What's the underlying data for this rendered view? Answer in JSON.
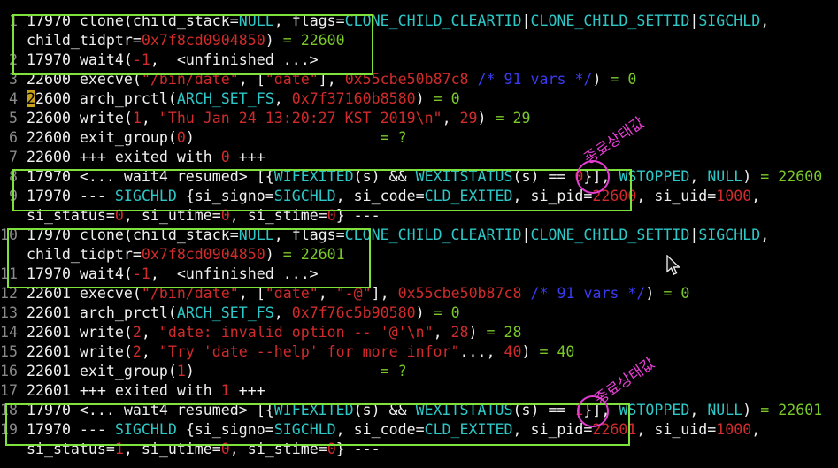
{
  "colors": {
    "default": "#f0f0f0",
    "lineno": "#8a8a8a",
    "number": "#d12b2b",
    "string": "#d12b2b",
    "const": "#2ec7c7",
    "comment": "#3a3af2",
    "result": "#7ac92a",
    "annot": "#e43fd2",
    "highlight_bg": "#c9a21c",
    "box": "#7ee23a"
  },
  "lines": [
    {
      "seg": [
        [
          "ln",
          " 1 "
        ],
        [
          "d",
          "17970 clone("
        ],
        [
          "d",
          "child_stack="
        ],
        [
          "c",
          "NULL"
        ],
        [
          "d",
          ", flags="
        ],
        [
          "c",
          "CLONE_CHILD_CLEARTID"
        ],
        [
          "d",
          "|"
        ],
        [
          "c",
          "CLONE_CHILD_SETTID"
        ],
        [
          "d",
          "|"
        ],
        [
          "c",
          "SIGCHLD"
        ],
        [
          "d",
          ","
        ]
      ]
    },
    {
      "seg": [
        [
          "d",
          "   child_tidptr="
        ],
        [
          "n",
          "0x7f8cd0904850"
        ],
        [
          "d",
          ")"
        ],
        [
          "r",
          " = 22600"
        ]
      ]
    },
    {
      "seg": [
        [
          "ln",
          " 2 "
        ],
        [
          "d",
          "17970 wait4("
        ],
        [
          "n",
          "-1"
        ],
        [
          "d",
          ",  <unfinished ...>"
        ]
      ]
    },
    {
      "seg": [
        [
          "ln",
          " 3 "
        ],
        [
          "d",
          "22600 execve("
        ],
        [
          "s",
          "\"/bin/date\""
        ],
        [
          "d",
          ", ["
        ],
        [
          "s",
          "\"date\""
        ],
        [
          "d",
          "], "
        ],
        [
          "n",
          "0x55cbe50b87c8"
        ],
        [
          "d",
          " "
        ],
        [
          "m",
          "/* 91 vars */"
        ],
        [
          "d",
          ")"
        ],
        [
          "r",
          " = 0"
        ]
      ]
    },
    {
      "seg": [
        [
          "ln",
          " 4 "
        ],
        [
          "h",
          "2"
        ],
        [
          "d",
          "2600 arch_prctl("
        ],
        [
          "c",
          "ARCH_SET_FS"
        ],
        [
          "d",
          ", "
        ],
        [
          "n",
          "0x7f37160b8580"
        ],
        [
          "d",
          ")"
        ],
        [
          "r",
          " = 0"
        ]
      ]
    },
    {
      "seg": [
        [
          "ln",
          " 5 "
        ],
        [
          "d",
          "22600 write("
        ],
        [
          "n",
          "1"
        ],
        [
          "d",
          ", "
        ],
        [
          "s",
          "\"Thu Jan 24 13:20:27 KST 2019\\n\""
        ],
        [
          "d",
          ", "
        ],
        [
          "n",
          "29"
        ],
        [
          "d",
          ")"
        ],
        [
          "r",
          " = 29"
        ]
      ]
    },
    {
      "seg": [
        [
          "ln",
          " 6 "
        ],
        [
          "d",
          "22600 exit_group("
        ],
        [
          "n",
          "0"
        ],
        [
          "d",
          ")                     "
        ],
        [
          "r",
          "= ?"
        ]
      ]
    },
    {
      "seg": [
        [
          "ln",
          " 7 "
        ],
        [
          "d",
          "22600 +++ exited with "
        ],
        [
          "n",
          "0"
        ],
        [
          "d",
          " +++"
        ]
      ]
    },
    {
      "seg": [
        [
          "ln",
          " 8 "
        ],
        [
          "d",
          "17970 <... wait4 resumed> [{"
        ],
        [
          "c",
          "WIFEXITED"
        ],
        [
          "d",
          "(s) && "
        ],
        [
          "c",
          "WEXITSTATUS"
        ],
        [
          "d",
          "(s) == "
        ],
        [
          "n",
          "0"
        ],
        [
          "d",
          "}], "
        ],
        [
          "c",
          "WSTOPPED"
        ],
        [
          "d",
          ", "
        ],
        [
          "c",
          "NULL"
        ],
        [
          "d",
          ")"
        ],
        [
          "r",
          " = 22600"
        ]
      ]
    },
    {
      "seg": [
        [
          "ln",
          " 9 "
        ],
        [
          "d",
          "17970 --- "
        ],
        [
          "c",
          "SIGCHLD"
        ],
        [
          "d",
          " {si_signo="
        ],
        [
          "c",
          "SIGCHLD"
        ],
        [
          "d",
          ", si_code="
        ],
        [
          "c",
          "CLD_EXITED"
        ],
        [
          "d",
          ", si_pid="
        ],
        [
          "n",
          "22600"
        ],
        [
          "d",
          ", si_uid="
        ],
        [
          "n",
          "1000"
        ],
        [
          "d",
          ","
        ]
      ]
    },
    {
      "seg": [
        [
          "d",
          "   si_status="
        ],
        [
          "n",
          "0"
        ],
        [
          "d",
          ", si_utime="
        ],
        [
          "n",
          "0"
        ],
        [
          "d",
          ", si_stime="
        ],
        [
          "n",
          "0"
        ],
        [
          "d",
          "} ---"
        ]
      ]
    },
    {
      "seg": [
        [
          "ln",
          "10 "
        ],
        [
          "d",
          "17970 clone("
        ],
        [
          "d",
          "child_stack="
        ],
        [
          "c",
          "NULL"
        ],
        [
          "d",
          ", flags="
        ],
        [
          "c",
          "CLONE_CHILD_CLEARTID"
        ],
        [
          "d",
          "|"
        ],
        [
          "c",
          "CLONE_CHILD_SETTID"
        ],
        [
          "d",
          "|"
        ],
        [
          "c",
          "SIGCHLD"
        ],
        [
          "d",
          ","
        ]
      ]
    },
    {
      "seg": [
        [
          "d",
          "   child_tidptr="
        ],
        [
          "n",
          "0x7f8cd0904850"
        ],
        [
          "d",
          ")"
        ],
        [
          "r",
          " = 22601"
        ]
      ]
    },
    {
      "seg": [
        [
          "ln",
          "11 "
        ],
        [
          "d",
          "17970 wait4("
        ],
        [
          "n",
          "-1"
        ],
        [
          "d",
          ",  <unfinished ...>"
        ]
      ]
    },
    {
      "seg": [
        [
          "ln",
          "12 "
        ],
        [
          "d",
          "22601 execve("
        ],
        [
          "s",
          "\"/bin/date\""
        ],
        [
          "d",
          ", ["
        ],
        [
          "s",
          "\"date\""
        ],
        [
          "d",
          ", "
        ],
        [
          "s",
          "\"-@\""
        ],
        [
          "d",
          "], "
        ],
        [
          "n",
          "0x55cbe50b87c8"
        ],
        [
          "d",
          " "
        ],
        [
          "m",
          "/* 91 vars */"
        ],
        [
          "d",
          ")"
        ],
        [
          "r",
          " = 0"
        ]
      ]
    },
    {
      "seg": [
        [
          "ln",
          "13 "
        ],
        [
          "d",
          "22601 arch_prctl("
        ],
        [
          "c",
          "ARCH_SET_FS"
        ],
        [
          "d",
          ", "
        ],
        [
          "n",
          "0x7f76c5b90580"
        ],
        [
          "d",
          ")"
        ],
        [
          "r",
          " = 0"
        ]
      ]
    },
    {
      "seg": [
        [
          "ln",
          "14 "
        ],
        [
          "d",
          "22601 write("
        ],
        [
          "n",
          "2"
        ],
        [
          "d",
          ", "
        ],
        [
          "s",
          "\"date: invalid option -- '@'\\n\""
        ],
        [
          "d",
          ", "
        ],
        [
          "n",
          "28"
        ],
        [
          "d",
          ")"
        ],
        [
          "r",
          " = 28"
        ]
      ]
    },
    {
      "seg": [
        [
          "ln",
          "15 "
        ],
        [
          "d",
          "22601 write("
        ],
        [
          "n",
          "2"
        ],
        [
          "d",
          ", "
        ],
        [
          "s",
          "\"Try 'date --help' for more infor\""
        ],
        [
          "d",
          "..., "
        ],
        [
          "n",
          "40"
        ],
        [
          "d",
          ")"
        ],
        [
          "r",
          " = 40"
        ]
      ]
    },
    {
      "seg": [
        [
          "ln",
          "16 "
        ],
        [
          "d",
          "22601 exit_group("
        ],
        [
          "n",
          "1"
        ],
        [
          "d",
          ")                     "
        ],
        [
          "r",
          "= ?"
        ]
      ]
    },
    {
      "seg": [
        [
          "ln",
          "17 "
        ],
        [
          "d",
          "22601 +++ exited with "
        ],
        [
          "n",
          "1"
        ],
        [
          "d",
          " +++"
        ]
      ]
    },
    {
      "seg": [
        [
          "ln",
          "18 "
        ],
        [
          "d",
          "17970 <... wait4 resumed> [{"
        ],
        [
          "c",
          "WIFEXITED"
        ],
        [
          "d",
          "(s) && "
        ],
        [
          "c",
          "WEXITSTATUS"
        ],
        [
          "d",
          "(s) == "
        ],
        [
          "n",
          "1"
        ],
        [
          "d",
          "}], "
        ],
        [
          "c",
          "WSTOPPED"
        ],
        [
          "d",
          ", "
        ],
        [
          "c",
          "NULL"
        ],
        [
          "d",
          ")"
        ],
        [
          "r",
          " = 22601"
        ]
      ]
    },
    {
      "seg": [
        [
          "ln",
          "19 "
        ],
        [
          "d",
          "17970 --- "
        ],
        [
          "c",
          "SIGCHLD"
        ],
        [
          "d",
          " {si_signo="
        ],
        [
          "c",
          "SIGCHLD"
        ],
        [
          "d",
          ", si_code="
        ],
        [
          "c",
          "CLD_EXITED"
        ],
        [
          "d",
          ", si_pid="
        ],
        [
          "n",
          "22601"
        ],
        [
          "d",
          ", si_uid="
        ],
        [
          "n",
          "1000"
        ],
        [
          "d",
          ","
        ]
      ]
    },
    {
      "seg": [
        [
          "d",
          "   si_status="
        ],
        [
          "n",
          "1"
        ],
        [
          "d",
          ", si_utime="
        ],
        [
          "n",
          "0"
        ],
        [
          "d",
          ", si_stime="
        ],
        [
          "n",
          "0"
        ],
        [
          "d",
          "} ---"
        ]
      ]
    }
  ],
  "annotations": [
    {
      "text": "종료상태값"
    },
    {
      "text": "종료상태값"
    }
  ],
  "cursor_icon": "mouse-pointer-icon"
}
